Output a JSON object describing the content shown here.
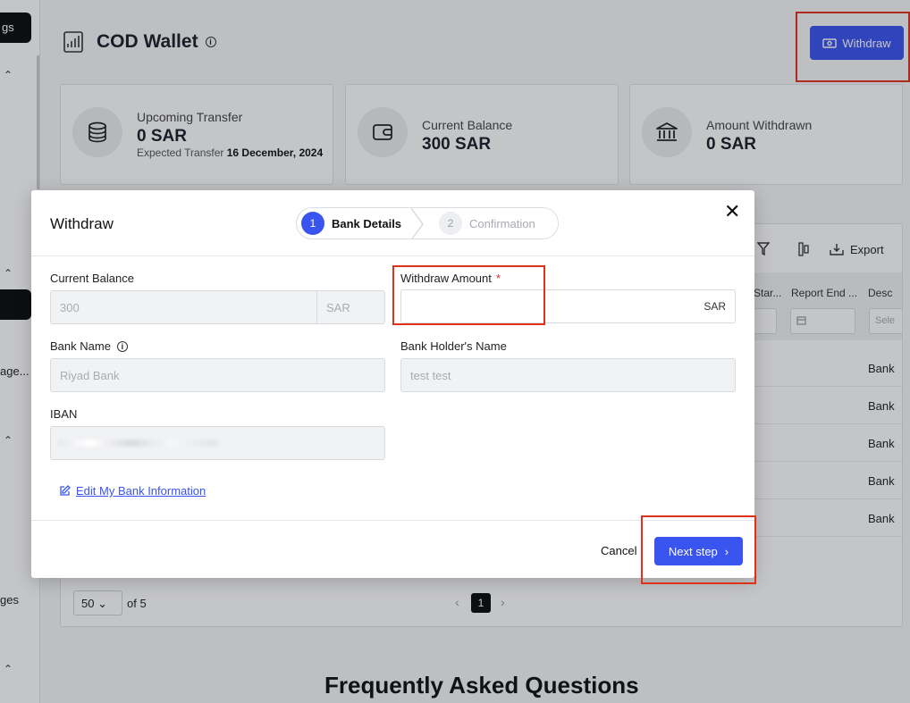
{
  "sidebar": {
    "top_item": "gs",
    "item_manage": "age...",
    "item_pages": "ges"
  },
  "header": {
    "title": "COD Wallet",
    "withdraw_label": "Withdraw"
  },
  "cards": [
    {
      "label": "Upcoming Transfer",
      "value": "0 SAR",
      "sub_label": "Expected Transfer",
      "sub_value": "16 December, 2024"
    },
    {
      "label": "Current Balance",
      "value": "300 SAR"
    },
    {
      "label": "Amount Withdrawn",
      "value": "0 SAR"
    }
  ],
  "table": {
    "export_label": "Export",
    "columns": [
      "Star...",
      "Report End ...",
      "Desc"
    ],
    "filter_select_placeholder": "Sele",
    "rows": [
      "Bank",
      "Bank",
      "Bank",
      "Bank",
      "Bank"
    ],
    "page_size": "50",
    "page_total": "of 5",
    "current_page": "1"
  },
  "faq_title": "Frequently Asked Questions",
  "modal": {
    "title": "Withdraw",
    "steps": [
      {
        "num": "1",
        "label": "Bank Details"
      },
      {
        "num": "2",
        "label": "Confirmation"
      }
    ],
    "fields": {
      "current_balance": {
        "label": "Current Balance",
        "value": "300",
        "suffix": "SAR"
      },
      "withdraw_amount": {
        "label": "Withdraw Amount",
        "required": "*",
        "value": "",
        "suffix": "SAR"
      },
      "bank_name": {
        "label": "Bank Name",
        "value": "Riyad Bank"
      },
      "holder_name": {
        "label": "Bank Holder's Name",
        "value": "test test"
      },
      "iban": {
        "label": "IBAN"
      }
    },
    "edit_link": "Edit My Bank Information",
    "cancel_label": "Cancel",
    "next_label": "Next step"
  },
  "colors": {
    "accent": "#3a54f0",
    "highlight": "#e0321b"
  }
}
